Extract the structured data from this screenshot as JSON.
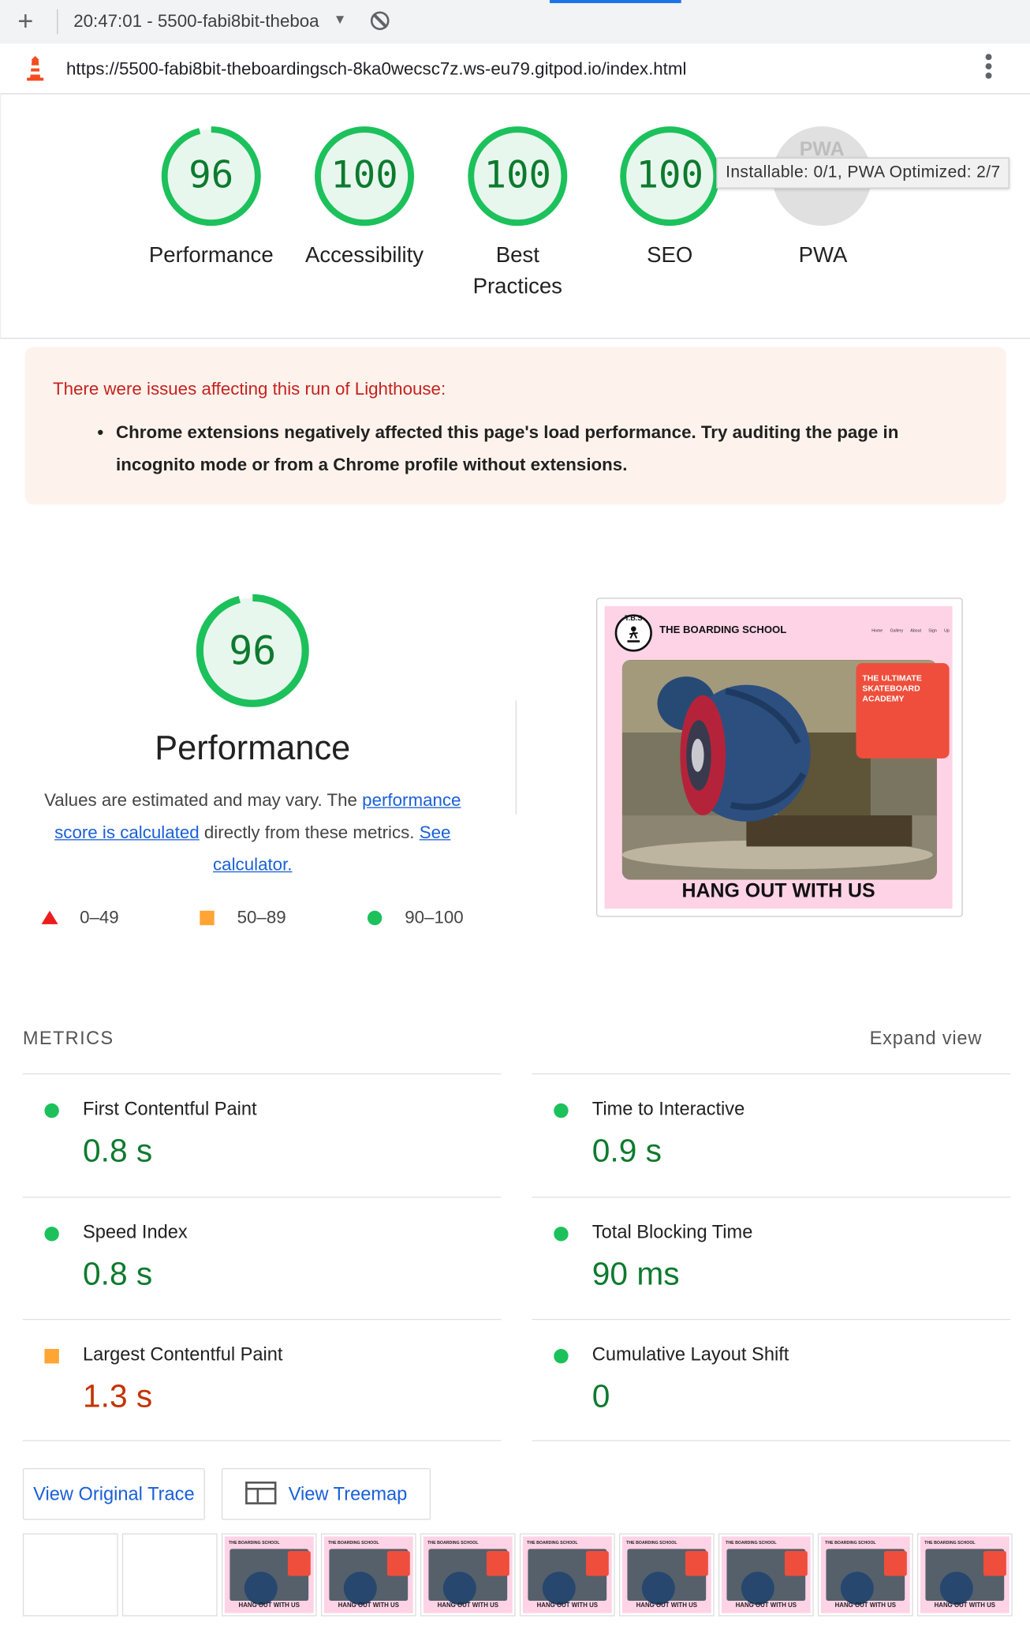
{
  "browser": {
    "tab_title": "20:47:01 - 5500-fabi8bit-theboa",
    "url": "https://5500-fabi8bit-theboardingsch-8ka0wecsc7z.ws-eu79.gitpod.io/index.html"
  },
  "scores": [
    {
      "label": "Performance",
      "score": "96",
      "value": 96
    },
    {
      "label": "Accessibility",
      "score": "100",
      "value": 100
    },
    {
      "label": "Best Practices",
      "score": "100",
      "value": 100
    },
    {
      "label": "SEO",
      "score": "100",
      "value": 100
    },
    {
      "label": "PWA",
      "score": "",
      "value": 0
    }
  ],
  "pwa": {
    "badge": "PWA",
    "tooltip": "Installable: 0/1, PWA Optimized: 2/7"
  },
  "warning": {
    "heading": "There were issues affecting this run of Lighthouse:",
    "item": "Chrome extensions negatively affected this page's load performance. Try auditing the page in incognito mode or from a Chrome profile without extensions."
  },
  "performance": {
    "score": "96",
    "title": "Performance",
    "desc_before": "Values are estimated and may vary. The ",
    "link1": "performance score is calculated",
    "desc_middle": " directly from these metrics. ",
    "link2": "See calculator.",
    "legend": {
      "poor": "0–49",
      "average": "50–89",
      "good": "90–100"
    }
  },
  "site_preview": {
    "name": "THE BOARDING SCHOOL",
    "nav": "Home Gallery About Sign Up",
    "hero": "THE ULTIMATE SKATEBOARD ACADEMY",
    "banner": "HANG OUT WITH US",
    "logo": "T.B.S"
  },
  "metrics": {
    "heading": "METRICS",
    "expand": "Expand view",
    "items": [
      {
        "label": "First Contentful Paint",
        "value": "0.8 s",
        "rating": "pass"
      },
      {
        "label": "Time to Interactive",
        "value": "0.9 s",
        "rating": "pass"
      },
      {
        "label": "Speed Index",
        "value": "0.8 s",
        "rating": "pass"
      },
      {
        "label": "Total Blocking Time",
        "value": "90 ms",
        "rating": "pass"
      },
      {
        "label": "Largest Contentful Paint",
        "value": "1.3 s",
        "rating": "average"
      },
      {
        "label": "Cumulative Layout Shift",
        "value": "0",
        "rating": "pass"
      }
    ]
  },
  "buttons": {
    "trace": "View Original Trace",
    "treemap": "View Treemap"
  },
  "filmstrip": {
    "caption": "HANG OUT WITH US",
    "header": "THE BOARDING SCHOOL"
  },
  "colors": {
    "pass": "#0cce6b",
    "average": "#ffa400",
    "fail": "#ff4e42",
    "link": "#1a5fd8"
  }
}
